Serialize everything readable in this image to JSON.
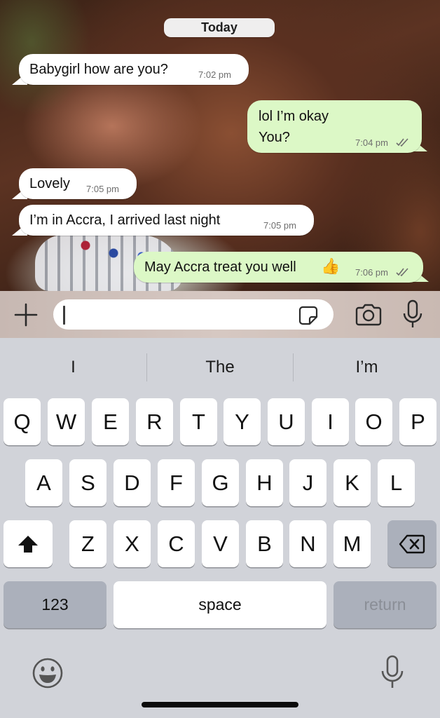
{
  "chat": {
    "date_label": "Today",
    "messages": [
      {
        "dir": "in",
        "text": "Babygirl how are you?",
        "time": "7:02 pm"
      },
      {
        "dir": "out",
        "line1": "lol I’m okay",
        "line2": "You?",
        "time": "7:04 pm",
        "status": "read-double-check-icon"
      },
      {
        "dir": "in",
        "text": "Lovely",
        "time": "7:05 pm"
      },
      {
        "dir": "in",
        "text": "I’m in Accra, I arrived last night",
        "time": "7:05 pm"
      },
      {
        "dir": "out",
        "text": "May Accra treat you well",
        "emoji": "👍",
        "time": "7:06 pm",
        "status": "read-double-check-icon"
      }
    ]
  },
  "input_bar": {
    "value": "",
    "icons": [
      "plus-icon",
      "sticker-icon",
      "camera-icon",
      "microphone-icon"
    ]
  },
  "keyboard": {
    "suggestions": [
      "I",
      "The",
      "I’m"
    ],
    "row1": [
      "Q",
      "W",
      "E",
      "R",
      "T",
      "Y",
      "U",
      "I",
      "O",
      "P"
    ],
    "row2": [
      "A",
      "S",
      "D",
      "F",
      "G",
      "H",
      "J",
      "K",
      "L"
    ],
    "row3": [
      "Z",
      "X",
      "C",
      "V",
      "B",
      "N",
      "M"
    ],
    "numbers_key": "123",
    "space_key": "space",
    "return_key": "return",
    "icons": [
      "shift-icon",
      "delete-icon",
      "emoji-icon",
      "dictation-mic-icon"
    ]
  },
  "colors": {
    "incoming_bubble": "#ffffff",
    "outgoing_bubble": "#dcf8c6",
    "read_ticks": "#6e6e6e",
    "key_light": "#ffffff",
    "key_dark": "#abb0bb",
    "keyboard_bg": "#d1d3d9"
  }
}
